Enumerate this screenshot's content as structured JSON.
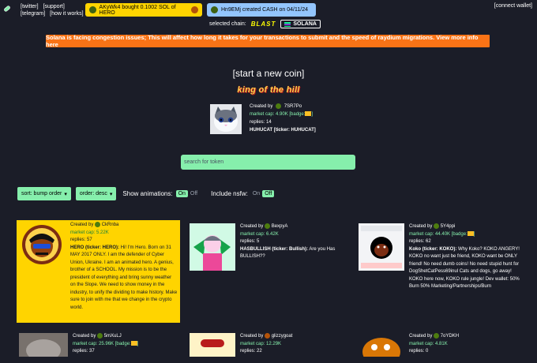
{
  "nav": {
    "links": [
      "[twitter]",
      "[support]",
      "[telegram]",
      "[how it works]"
    ],
    "connect": "[connect wallet]"
  },
  "tickers": [
    {
      "text": "AKyWk4  bought 0.1002 SOL of HERO",
      "color": "#ffd400"
    },
    {
      "text": "Hn9EMj  created CASH  on 04/11/24",
      "color": "#93c5fd"
    }
  ],
  "chain": {
    "label": "selected chain:",
    "blast": "BLAST",
    "solana": "SOLANA"
  },
  "banner": "Solana is facing congestion issues; This will affect how long it takes for your transactions to submit and the speed of raydium migrations. View more info here",
  "start": "[start a new coin]",
  "koth": {
    "title": "king of the hill",
    "created_by": "Created by",
    "user": "7SR7Po",
    "market_cap": "market cap: 4.90K",
    "badge": "[badge:",
    "replies": "replies: 14",
    "name": "HUHUCAT [ticker: HUHUCAT]"
  },
  "search": {
    "placeholder": "search for token"
  },
  "controls": {
    "sort": "sort: bump order",
    "order": "order: desc",
    "animations_label": "Show animations:",
    "nsfw_label": "Include nsfw:",
    "on": "On",
    "off": "Off"
  },
  "coins": [
    {
      "user": "CkRnba",
      "mc": "market cap: 5.22K",
      "replies": "replies: 57",
      "title": "HERO (ticker: HERO):",
      "desc": "Hi! I'm Hero. Born on 31 MAY 2017 ONLY. I am the defender of Cyber Union, Ukraine. I am an animated hero. A genius, brother of a SCHOOL. My mission is to be the president of everything and bring sunny weather on the Slope. We need to show money in the industry, to unify the dividing to make history. Make sure to join with me that we change in the crypto world."
    },
    {
      "user": "BexpyA",
      "mc": "market cap: 6.42K",
      "replies": "replies: 5",
      "title": "HASBULLISH (ticker: Bullish):",
      "desc": "Are you Has BULLISH??"
    },
    {
      "user": "5Y4ppi",
      "mc": "market cap: 44.40K",
      "replies": "replies: 62",
      "title": "Koko (ticker: KOKO):",
      "desc": "Why Koko? KOKO ANGERY! KOKO no want just be friend, KOKO want be ONLY friend! No need dumb coins! No need stupid hunt for DogShetCatPess69inul Cats and dogs, go away! KOKO here now, KOKO rule jungle! Dev wallet: 50% Burn 50% Marketing/Partnerships/Burn"
    },
    {
      "user": "5mXuLJ",
      "mc": "market cap: 25.96K",
      "replies": "replies: 37",
      "title": "",
      "desc": ""
    },
    {
      "user": "glizzygoat",
      "mc": "market cap: 12.29K",
      "replies": "replies: 22",
      "title": "",
      "desc": ""
    },
    {
      "user": "7oYDKH",
      "mc": "market cap: 4.81K",
      "replies": "replies: 0",
      "title": "",
      "desc": ""
    }
  ],
  "common": {
    "created_by": "Created by",
    "badge": "[badge:"
  }
}
